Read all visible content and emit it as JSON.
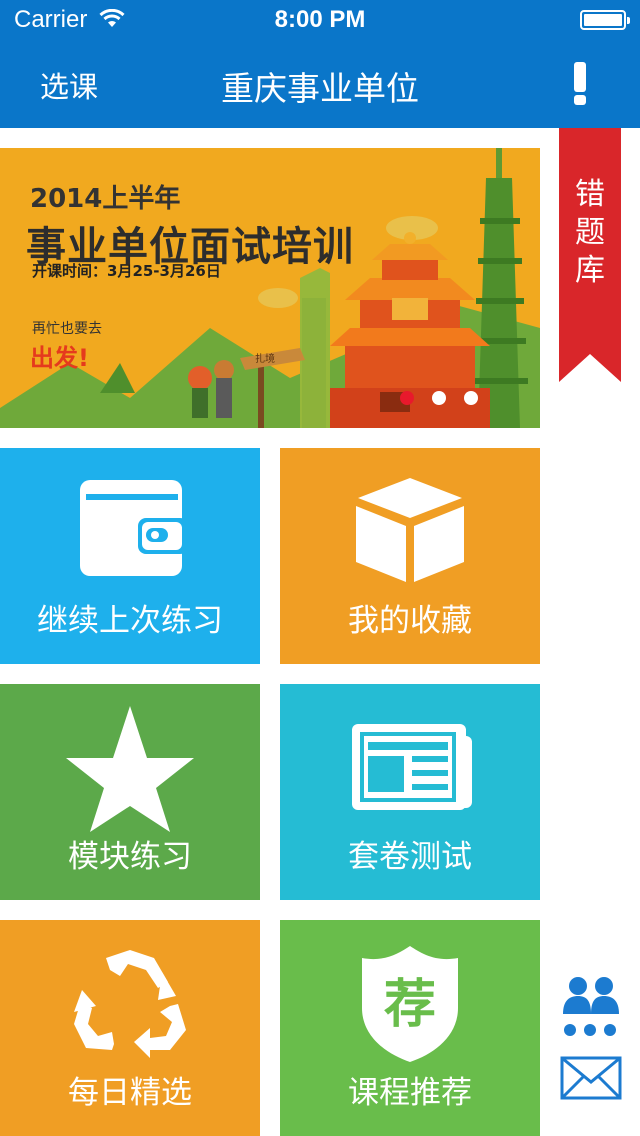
{
  "status_bar": {
    "carrier": "Carrier",
    "time": "8:00 PM"
  },
  "nav": {
    "left_label": "选课",
    "title": "重庆事业单位"
  },
  "banner": {
    "year": "2014上半年",
    "headline": "事业单位面试培训",
    "schedule": "开课时间：3月25-3月26日",
    "slogan_small": "再忙也要去",
    "slogan_big": "出发!",
    "sign_text": "扎境",
    "page_count": 3,
    "active_page": 1
  },
  "ribbon": {
    "line1": "错",
    "line2": "题",
    "line3": "库",
    "color": "#d9262a"
  },
  "tiles": [
    {
      "label": "继续上次练习",
      "icon": "wallet-icon",
      "color": "#1eb0ec"
    },
    {
      "label": "我的收藏",
      "icon": "box-icon",
      "color": "#f09e24"
    },
    {
      "label": "模块练习",
      "icon": "star-icon",
      "color": "#5ca94a"
    },
    {
      "label": "套卷测试",
      "icon": "newspaper-icon",
      "color": "#25bcd4"
    },
    {
      "label": "每日精选",
      "icon": "recycle-icon",
      "color": "#f09e24"
    },
    {
      "label": "课程推荐",
      "icon": "recommend-shield-icon",
      "color": "#69bd4b",
      "badge": "荐"
    }
  ],
  "side_icons": [
    "users-icon",
    "mail-icon"
  ],
  "colors": {
    "nav_bg": "#0a76c9",
    "accent_blue": "#1c7bd0"
  }
}
